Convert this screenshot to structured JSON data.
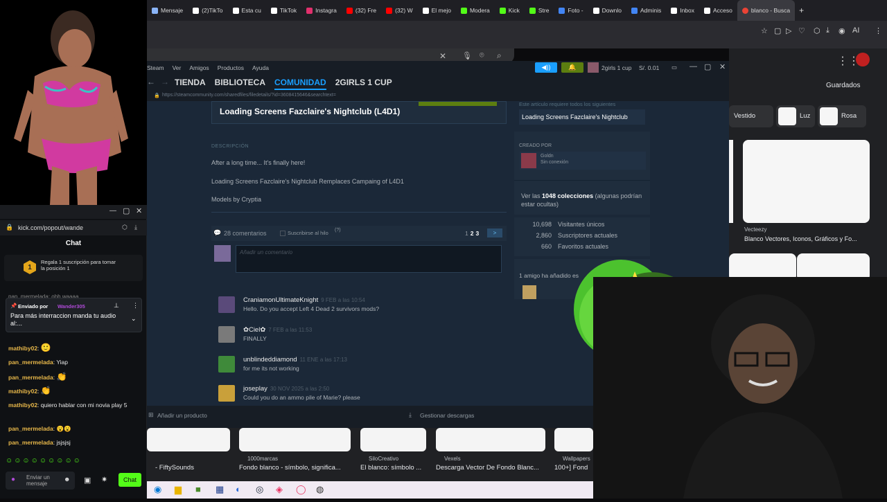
{
  "browser": {
    "tabs": [
      {
        "label": "Mensaje",
        "color": "#8ab4f8"
      },
      {
        "label": "(2)TikTo",
        "color": "#ffffff"
      },
      {
        "label": "Esta cu",
        "color": "#ffffff"
      },
      {
        "label": "TikTok",
        "color": "#ffffff"
      },
      {
        "label": "Instagra",
        "color": "#e1306c"
      },
      {
        "label": "(32) Fre",
        "color": "#ff0000"
      },
      {
        "label": "(32) W",
        "color": "#ff0000"
      },
      {
        "label": "El mejo",
        "color": "#ffffff"
      },
      {
        "label": "Modera",
        "color": "#53fc18"
      },
      {
        "label": "Kick",
        "color": "#53fc18"
      },
      {
        "label": "Stre",
        "color": "#53fc18"
      },
      {
        "label": "Foto -",
        "color": "#4285f4"
      },
      {
        "label": "Downlo",
        "color": "#ffffff"
      },
      {
        "label": "Adminis",
        "color": "#4285f4"
      },
      {
        "label": "Inbox",
        "color": "#ffffff"
      },
      {
        "label": "Acceso",
        "color": "#ffffff"
      }
    ],
    "active_tab": "blanco - Busca",
    "new_tab": "+",
    "ai_label": "AI",
    "saved_label": "Guardados"
  },
  "google_images": {
    "chips": [
      {
        "label": "Vestido"
      },
      {
        "label": "Luz"
      },
      {
        "label": "Rosa"
      }
    ],
    "right_result": {
      "source": "Vecteezy",
      "title": "Blanco Vectores, Iconos, Gráficos y Fo..."
    },
    "bottom_results": [
      {
        "source": "",
        "title": "- FiftySounds"
      },
      {
        "source": "1000marcas",
        "title": "Fondo blanco - símbolo, significa..."
      },
      {
        "source": "SiloCreativo",
        "title": "El blanco: símbolo ..."
      },
      {
        "source": "Vexels",
        "title": "Descarga Vector De Fondo Blanc..."
      },
      {
        "source": "Wallpapers",
        "title": "100+] Fond"
      }
    ]
  },
  "steam": {
    "menu": [
      "Steam",
      "Ver",
      "Amigos",
      "Productos",
      "Ayuda"
    ],
    "user": "2girls 1 cup",
    "wallet": "S/. 0.01",
    "nav": [
      "TIENDA",
      "BIBLIOTECA",
      "COMUNIDAD",
      "2GIRLS 1 CUP"
    ],
    "url": "https://steamcommunity.com/sharedfiles/filedetails/?id=3608415646&searchtext=",
    "item_title": "Loading Screens Fazclaire's Nightclub (L4D1)",
    "description_header": "DESCRIPCIÓN",
    "description": [
      "After a long time... It's finally here!",
      "Loading Screens Fazclaire's Nightclub Remplaces Campaing of L4D1",
      "Models by Cryptia"
    ],
    "comments_count": "28 comentarios",
    "subscribe_thread": "Suscribirse al hilo",
    "pages": [
      "1",
      "2",
      "3"
    ],
    "next": ">",
    "comment_placeholder": "Añadir un comentario",
    "comments": [
      {
        "name": "CraniamonUltimateKnight",
        "date": "9 FEB a las 10:54",
        "text": "Hello. Do you accept Left 4 Dead 2 survivors mods?",
        "color": "#5a4a7a"
      },
      {
        "name": "✿Ciel✿",
        "date": "7 FEB a las 11:53",
        "text": "FINALLY",
        "color": "#7a7a7a"
      },
      {
        "name": "unblindeddiamond",
        "date": "11 ENE a las 17:13",
        "text": "for me its not working",
        "color": "#3f8a3a"
      },
      {
        "name": "joseplay",
        "date": "30 NOV 2025 a las 2:50",
        "text": "Could you do an ammo pile of Marie? please",
        "color": "#c9a03a"
      }
    ],
    "sidebar": {
      "requires_note": "Este artículo requiere todos los siguientes",
      "required_item": "Loading Screens Fazclaire's Nightclub",
      "created_by": "CREADO POR",
      "creator_name": "Goldn",
      "creator_status": "Sin conexión",
      "collections_pre": "Ver las",
      "collections_count": "1048 colecciones",
      "collections_post": "(algunas podrían estar ocultas)",
      "stats": [
        {
          "value": "10,698",
          "label": "Visitantes únicos"
        },
        {
          "value": "2,860",
          "label": "Suscriptores actuales"
        },
        {
          "value": "660",
          "label": "Favoritos actuales"
        }
      ],
      "friends_added": "1 amigo ha añadido es"
    },
    "footer_add": "Añadir un producto",
    "footer_downloads": "Gestionar descargas"
  },
  "kick": {
    "url": "kick.com/popout/wande",
    "chat_title": "Chat",
    "gift_banner_count": "1",
    "gift_banner": "Regala 1 suscripción para tomar la posición 1",
    "partial_line": "pan_mermelada: ohh waaaa",
    "pinned_by_label": "Enviado por",
    "pinned_by_user": "Wander305",
    "pinned_text": "Para más interraccion manda tu audio al:...",
    "messages": [
      {
        "user": "mathiby02",
        "text": "",
        "color": "#e8b84a",
        "emote": "🙂"
      },
      {
        "user": "pan_mermelada",
        "text": "Yiap",
        "color": "#e8b84a",
        "emote": ""
      },
      {
        "user": "pan_mermelada",
        "text": "",
        "color": "#e8b84a",
        "emote": "👏"
      },
      {
        "user": "mathiby02",
        "text": "",
        "color": "#e8b84a",
        "emote": "👏"
      },
      {
        "user": "mathiby02",
        "text": "quiero hablar con mi novia play 5",
        "color": "#e8b84a",
        "emote": ""
      },
      {
        "user": "pan_mermelada",
        "text": "😮😮",
        "color": "#e8b84a",
        "emote": ""
      },
      {
        "user": "pan_mermelada",
        "text": "jsjsjsj",
        "color": "#e8b84a",
        "emote": ""
      }
    ],
    "input_placeholder": "Enviar un mensaje",
    "chat_button": "Chat"
  }
}
